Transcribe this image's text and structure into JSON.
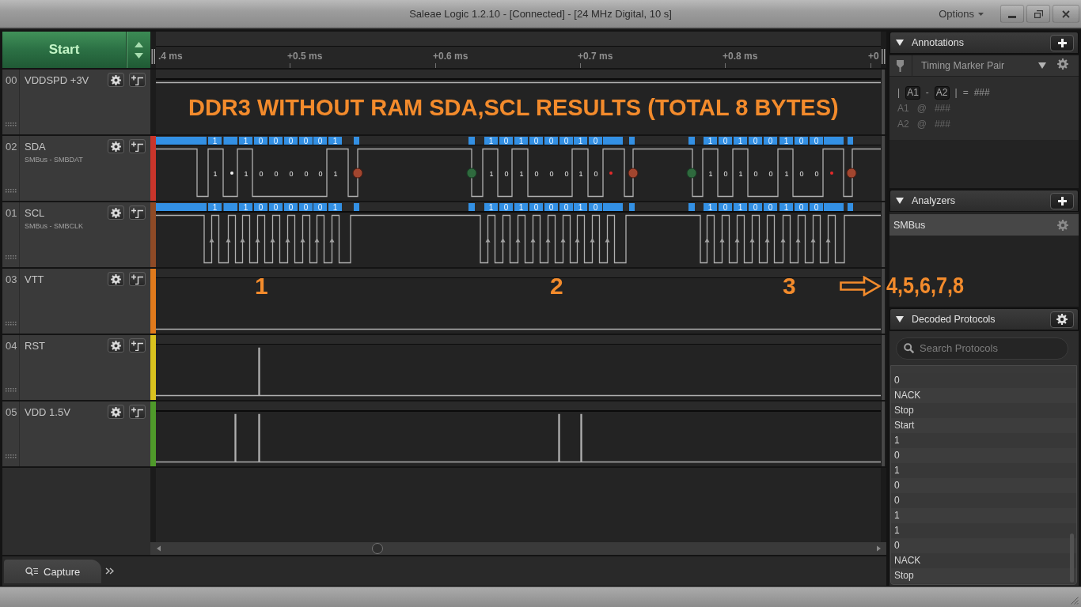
{
  "window": {
    "title": "Saleae Logic 1.2.10 - [Connected] - [24 MHz Digital, 10 s]",
    "options_menu": "Options"
  },
  "capture": {
    "start_button": "Start"
  },
  "ruler": {
    "ticks": [
      ".4 ms",
      "+0.5 ms",
      "+0.6 ms",
      "+0.7 ms",
      "+0.8 ms",
      "+0"
    ]
  },
  "channels": [
    {
      "number": "00",
      "name": "VDDSPD +3V",
      "color": "#1c1c1c",
      "kind": "high"
    },
    {
      "number": "02",
      "name": "SDA",
      "analyzer": "SMBus - SMBDAT",
      "color": "#c9352b",
      "kind": "data",
      "packets": [
        {
          "bubbles": [
            "1",
            "1",
            "0",
            "0",
            "0",
            "0",
            "0",
            "1"
          ],
          "bits": [
            "1",
            "1",
            "0",
            "0",
            "0",
            "0",
            "0",
            "1"
          ],
          "acked": true
        },
        {
          "bubbles": [
            "1",
            "0",
            "1",
            "0",
            "0",
            "0",
            "1",
            "0"
          ],
          "bits": [
            "1",
            "0",
            "1",
            "0",
            "0",
            "0",
            "1",
            "0"
          ],
          "acked": false
        },
        {
          "bubbles": [
            "1",
            "0",
            "1",
            "0",
            "0",
            "1",
            "0",
            "0"
          ],
          "bits": [
            "1",
            "0",
            "1",
            "0",
            "0",
            "1",
            "0",
            "0"
          ],
          "acked": false
        }
      ]
    },
    {
      "number": "01",
      "name": "SCL",
      "analyzer": "SMBus - SMBCLK",
      "color": "#8e4a26",
      "kind": "clock",
      "packets": [
        {
          "bubbles": [
            "1",
            "1",
            "0",
            "0",
            "0",
            "0",
            "0",
            "1"
          ]
        },
        {
          "bubbles": [
            "1",
            "0",
            "1",
            "0",
            "0",
            "0",
            "1",
            "0"
          ]
        },
        {
          "bubbles": [
            "1",
            "0",
            "1",
            "0",
            "0",
            "1",
            "0",
            "0"
          ]
        }
      ]
    },
    {
      "number": "03",
      "name": "VTT",
      "color": "#e07a1c",
      "kind": "low"
    },
    {
      "number": "04",
      "name": "RST",
      "color": "#d9c21e",
      "kind": "glitch"
    },
    {
      "number": "05",
      "name": "VDD 1.5V",
      "color": "#4f9a2a",
      "kind": "glitch"
    }
  ],
  "tabs": [
    {
      "label": "Capture",
      "selected": true
    }
  ],
  "annotations": {
    "title": "Annotations",
    "expanded": true,
    "type_label": "Timing Marker Pair",
    "formula": {
      "open": "|",
      "first": "A1",
      "minus": "-",
      "second": "A2",
      "close": "|",
      "equals": "=",
      "value": "###"
    },
    "markers": [
      {
        "name": "A1",
        "at": "@",
        "value": "###"
      },
      {
        "name": "A2",
        "at": "@",
        "value": "###"
      }
    ]
  },
  "analyzers": {
    "title": "Analyzers",
    "expanded": true,
    "items": [
      {
        "label": "SMBus"
      }
    ]
  },
  "decoded_protocols": {
    "title": "Decoded Protocols",
    "expanded": true,
    "search": {
      "placeholder": "Search Protocols"
    },
    "results": [
      {
        "label": "0",
        "selected": false
      },
      {
        "label": "NACK",
        "selected": false
      },
      {
        "label": "Stop",
        "selected": false
      },
      {
        "label": "Start",
        "selected": false
      },
      {
        "label": "1",
        "selected": false
      },
      {
        "label": "0",
        "selected": false
      },
      {
        "label": "1",
        "selected": false
      },
      {
        "label": "0",
        "selected": false
      },
      {
        "label": "0",
        "selected": false
      },
      {
        "label": "1",
        "selected": false
      },
      {
        "label": "1",
        "selected": false
      },
      {
        "label": "0",
        "selected": false
      },
      {
        "label": "NACK",
        "selected": false
      },
      {
        "label": "Stop",
        "selected": false
      }
    ]
  },
  "overlay": {
    "headline": "DDR3 WITHOUT RAM SDA,SCL RESULTS (TOTAL 8 BYTES)",
    "group_labels": [
      "1",
      "2",
      "3"
    ],
    "continuation": "4,5,6,7,8"
  }
}
